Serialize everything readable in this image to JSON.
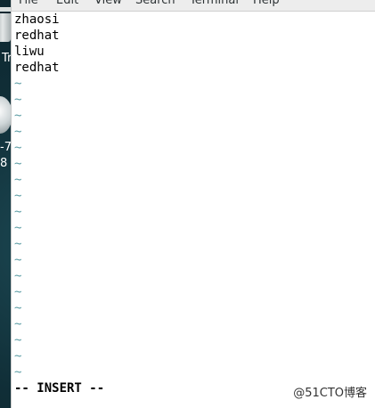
{
  "desktop": {
    "trash_label": "Tr",
    "disc_label_line1": "-7",
    "disc_label_line2": "8"
  },
  "menubar": {
    "items": [
      "File",
      "Edit",
      "View",
      "Search",
      "Terminal",
      "Help"
    ]
  },
  "editor": {
    "lines": [
      "zhaosi",
      "redhat",
      "liwu",
      "redhat"
    ],
    "tilde": "~",
    "mode_status": "-- INSERT --"
  },
  "watermark": "@51CTO博客",
  "colors": {
    "tilde": "#5f9ea6",
    "desktop_bg": "#0f2a33",
    "menubar_bg": "#ededed"
  }
}
